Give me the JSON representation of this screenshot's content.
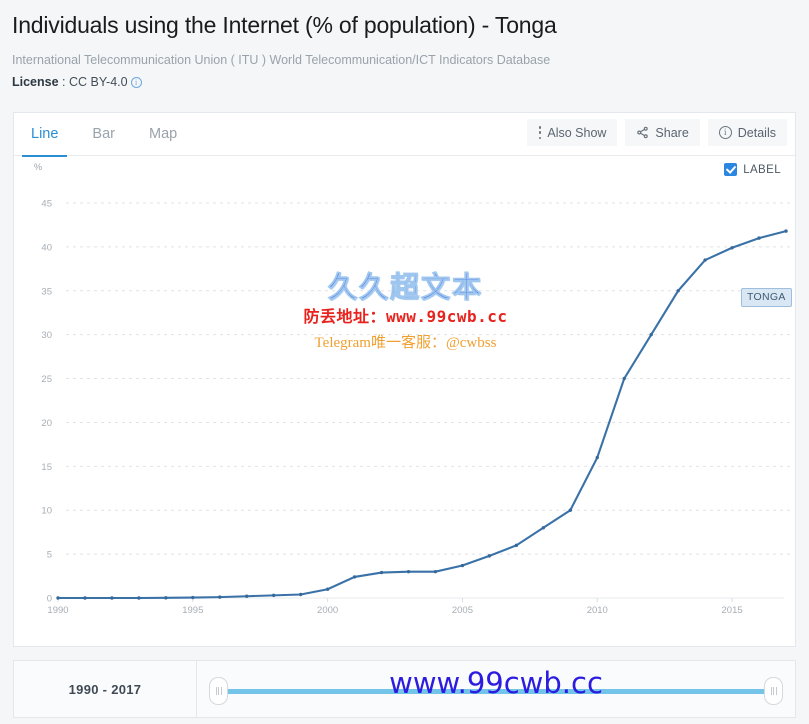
{
  "header": {
    "title": "Individuals using the Internet (% of population) - Tonga",
    "source": "International Telecommunication Union ( ITU ) World Telecommunication/ICT Indicators Database",
    "license_label": "License",
    "license_sep": " : ",
    "license_value": "CC BY-4.0",
    "info_icon": "info-icon"
  },
  "tabs": [
    {
      "label": "Line",
      "active": true
    },
    {
      "label": "Bar",
      "active": false
    },
    {
      "label": "Map",
      "active": false
    }
  ],
  "actions": [
    {
      "label": "Also Show",
      "icon": "kebab-menu-icon"
    },
    {
      "label": "Share",
      "icon": "share-icon"
    },
    {
      "label": "Details",
      "icon": "info-circle-icon"
    }
  ],
  "plot": {
    "unit": "%",
    "label_toggle": "LABEL",
    "label_toggle_checked": true,
    "series_badge": "TONGA"
  },
  "watermark": {
    "line1": "久久超文本",
    "line2": "防丢地址：www.99cwb.cc",
    "line3": "Telegram唯一客服：@cwbss",
    "footer": "www.99cwb.cc"
  },
  "footer": {
    "range_label": "1990 - 2017",
    "slider_left_handle": "range-start-handle",
    "slider_right_handle": "range-end-handle"
  },
  "colors": {
    "accent": "#2b8fd6",
    "series": "#3a72a8",
    "checkbox": "#2b86e0",
    "badge_bg": "#d9e7f4",
    "slider_track": "#74c3e8"
  },
  "chart_data": {
    "type": "line",
    "title": "Individuals using the Internet (% of population) - Tonga",
    "xlabel": "",
    "ylabel": "%",
    "xlim": [
      1990,
      2017
    ],
    "ylim": [
      0,
      46
    ],
    "yticks": [
      0,
      5,
      10,
      15,
      20,
      25,
      30,
      35,
      40,
      45
    ],
    "xticks": [
      1990,
      1995,
      2000,
      2005,
      2010,
      2015
    ],
    "grid": true,
    "legend": "TONGA",
    "legend_position": "inline-end-of-line",
    "x": [
      1990,
      1991,
      1992,
      1993,
      1994,
      1995,
      1996,
      1997,
      1998,
      1999,
      2000,
      2001,
      2002,
      2003,
      2004,
      2005,
      2006,
      2007,
      2008,
      2009,
      2010,
      2011,
      2012,
      2013,
      2014,
      2015,
      2016,
      2017
    ],
    "series": [
      {
        "name": "TONGA",
        "values": [
          0.0,
          0.0,
          0.0,
          0.0,
          0.02,
          0.05,
          0.1,
          0.2,
          0.3,
          0.4,
          1.0,
          2.4,
          2.9,
          3.0,
          3.0,
          3.7,
          4.8,
          6.0,
          8.0,
          10.0,
          16.0,
          25.0,
          30.0,
          35.0,
          38.5,
          39.9,
          41.0,
          41.8
        ]
      }
    ]
  }
}
